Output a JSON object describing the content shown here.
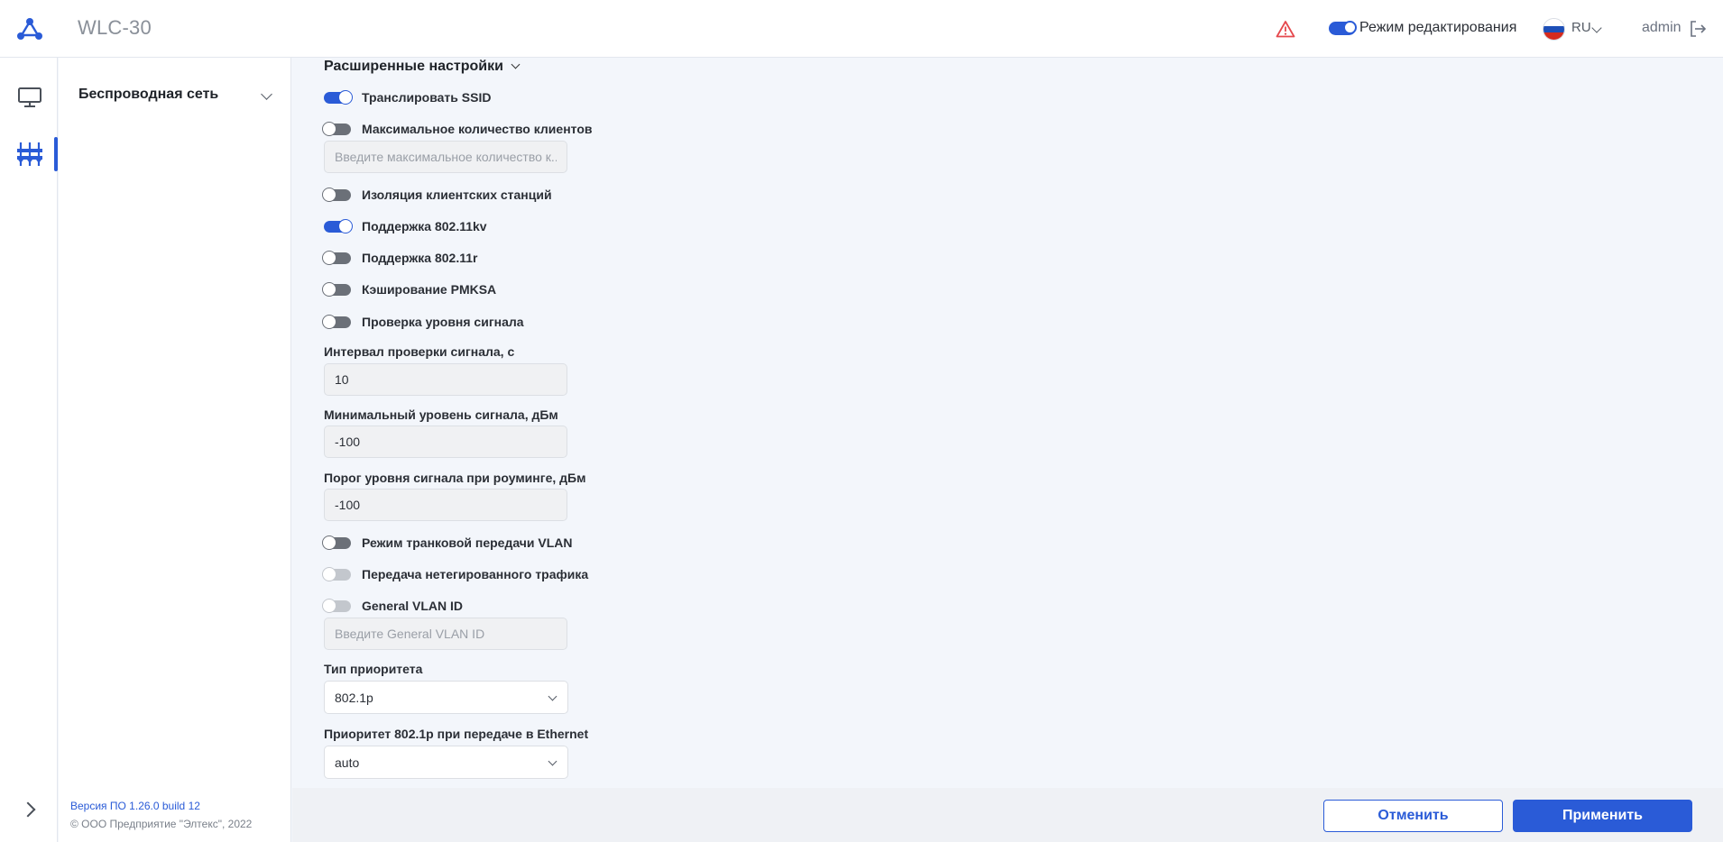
{
  "header": {
    "app_title": "WLC-30",
    "edit_mode_label": "Режим редактирования",
    "edit_mode_on": true,
    "language": "RU",
    "user": "admin"
  },
  "sidebar": {
    "items": [
      {
        "label": "Беспроводная сеть"
      }
    ],
    "version": "Версия ПО 1.26.0 build 12",
    "copyright": "© ООО Предприятие \"Элтекс\", 2022"
  },
  "form": {
    "section_title": "Расширенные настройки",
    "toggles": {
      "broadcast_ssid": {
        "label": "Транслировать SSID",
        "on": true
      },
      "max_clients": {
        "label": "Максимальное количество клиентов",
        "on": false
      },
      "client_isolation": {
        "label": "Изоляция клиентских станций",
        "on": false
      },
      "support_80211kv": {
        "label": "Поддержка 802.11kv",
        "on": true
      },
      "support_80211r": {
        "label": "Поддержка 802.11r",
        "on": false
      },
      "pmksa_caching": {
        "label": "Кэширование PMKSA",
        "on": false
      },
      "signal_check": {
        "label": "Проверка уровня сигнала",
        "on": false
      },
      "vlan_trunk": {
        "label": "Режим транковой передачи VLAN",
        "on": false
      },
      "untagged_traffic": {
        "label": "Передача нетегированного трафика",
        "on": false,
        "disabled": true
      },
      "general_vlan": {
        "label": "General VLAN ID",
        "on": false,
        "disabled": true
      }
    },
    "max_clients_placeholder": "Введите максимальное количество к...",
    "signal_interval": {
      "label": "Интервал проверки сигнала, с",
      "value": "10"
    },
    "min_signal": {
      "label": "Минимальный уровень сигнала, дБм",
      "value": "-100"
    },
    "roaming_threshold": {
      "label": "Порог уровня сигнала при роуминге, дБм",
      "value": "-100"
    },
    "general_vlan_placeholder": "Введите General VLAN ID",
    "priority_type": {
      "label": "Тип приоритета",
      "value": "802.1p"
    },
    "eth_priority": {
      "label": "Приоритет 802.1p при передаче в Ethernet",
      "value": "auto"
    }
  },
  "footer": {
    "cancel_label": "Отменить",
    "apply_label": "Применить"
  },
  "colors": {
    "accent": "#2a5bd7",
    "warning": "#e5484d"
  },
  "icons": [
    "logo-icon",
    "warning-icon",
    "flag-ru-icon",
    "chevron-down-icon",
    "logout-icon",
    "monitor-icon",
    "network-icon",
    "chevron-right-icon"
  ]
}
